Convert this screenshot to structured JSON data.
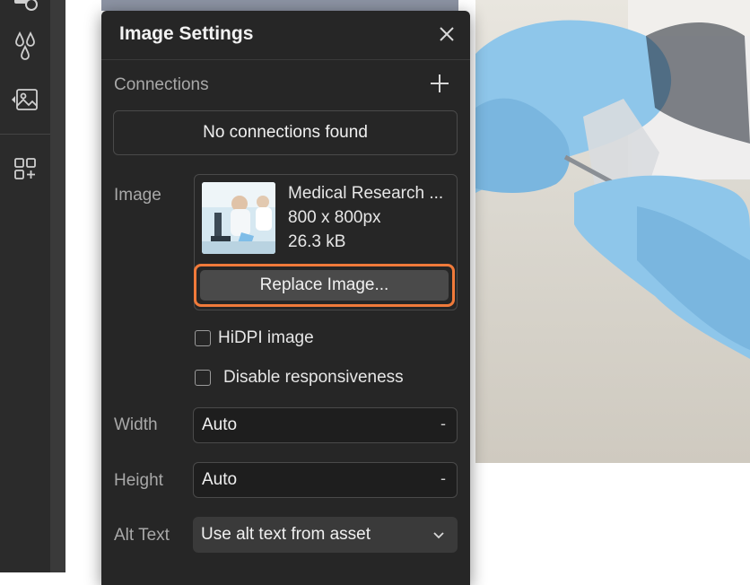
{
  "panel": {
    "title": "Image Settings",
    "connections_label": "Connections",
    "no_connections": "No connections found",
    "image_label": "Image",
    "image": {
      "name": "Medical Research ...",
      "dimensions": "800 x 800px",
      "size": "26.3 kB"
    },
    "replace_button": "Replace Image...",
    "hidpi_label": "HiDPI image",
    "hidpi_checked": false,
    "disable_resp_label": "Disable responsiveness",
    "disable_resp_checked": false,
    "width_label": "Width",
    "width_value": "Auto",
    "width_unit": "-",
    "height_label": "Height",
    "height_value": "Auto",
    "height_unit": "-",
    "alt_label": "Alt Text",
    "alt_value": "Use alt text from asset"
  },
  "colors": {
    "panel_bg": "#262626",
    "accent_outline": "#f07a3a",
    "glove_blue": "#8ec6ea"
  },
  "sidebar": {
    "icons": [
      "cms-icon",
      "drops-icon",
      "image-asset-icon",
      "add-apps-icon"
    ]
  }
}
